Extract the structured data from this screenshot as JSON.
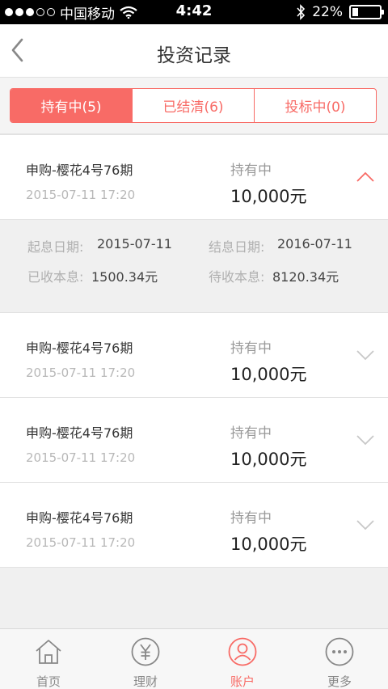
{
  "status_bar": {
    "carrier": "中国移动",
    "time": "4:42",
    "battery": "22%",
    "battery_level": 0.22
  },
  "nav": {
    "title": "投资记录"
  },
  "tabs": [
    {
      "label": "持有中(5)",
      "active": true
    },
    {
      "label": "已结清(6)",
      "active": false
    },
    {
      "label": "投标中(0)",
      "active": false
    }
  ],
  "records": [
    {
      "name": "申购-樱花4号76期",
      "time": "2015-07-11 17:20",
      "status": "持有中",
      "amount": "10,000元",
      "expanded": true
    },
    {
      "name": "申购-樱花4号76期",
      "time": "2015-07-11 17:20",
      "status": "持有中",
      "amount": "10,000元",
      "expanded": false
    },
    {
      "name": "申购-樱花4号76期",
      "time": "2015-07-11 17:20",
      "status": "持有中",
      "amount": "10,000元",
      "expanded": false
    },
    {
      "name": "申购-樱花4号76期",
      "time": "2015-07-11 17:20",
      "status": "持有中",
      "amount": "10,000元",
      "expanded": false
    }
  ],
  "detail": {
    "start_label": "起息日期:",
    "start_value": "2015-07-11",
    "end_label": "结息日期:",
    "end_value": "2016-07-11",
    "received_label": "已收本息:",
    "received_value": "1500.34元",
    "pending_label": "待收本息:",
    "pending_value": "8120.34元"
  },
  "tabbar": [
    {
      "label": "首页",
      "icon": "home-icon",
      "active": false
    },
    {
      "label": "理财",
      "icon": "yen-icon",
      "active": false
    },
    {
      "label": "账户",
      "icon": "account-icon",
      "active": true
    },
    {
      "label": "更多",
      "icon": "more-icon",
      "active": false
    }
  ],
  "colors": {
    "accent": "#f86b66",
    "inactive": "#888888",
    "muted": "#b8b8b8"
  }
}
